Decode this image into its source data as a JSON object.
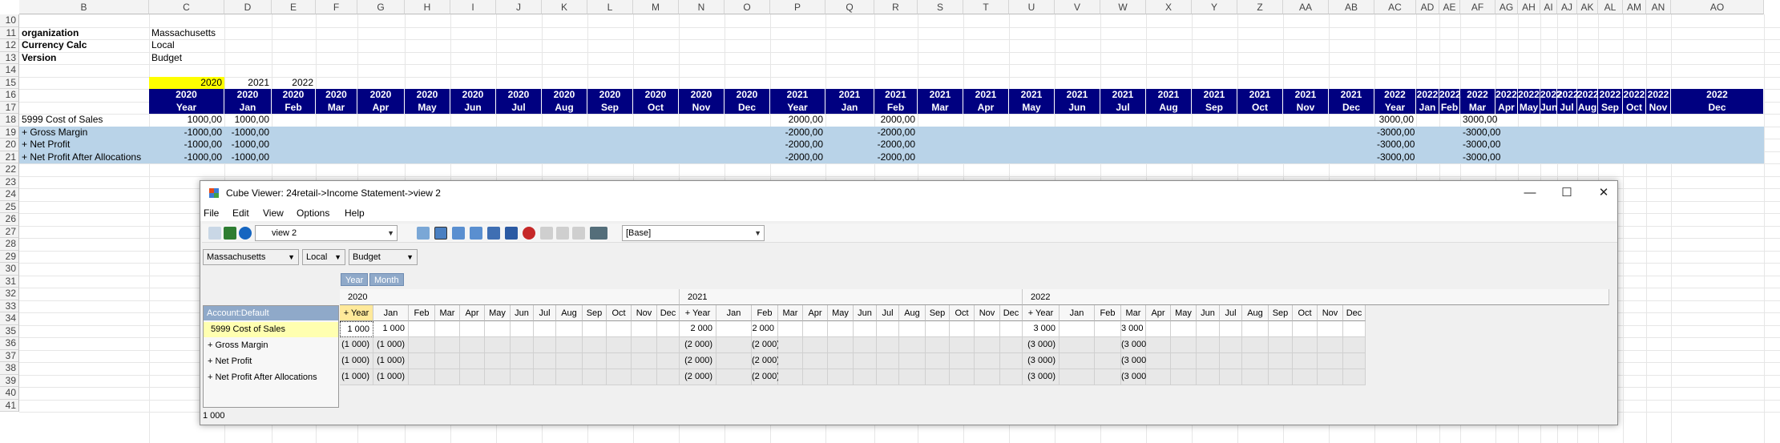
{
  "sheet": {
    "columns": [
      "B",
      "C",
      "D",
      "E",
      "F",
      "G",
      "H",
      "I",
      "J",
      "K",
      "L",
      "M",
      "N",
      "O",
      "P",
      "Q",
      "R",
      "S",
      "T",
      "U",
      "V",
      "W",
      "X",
      "Y",
      "Z",
      "AA",
      "AB",
      "AC",
      "AD",
      "AE",
      "AF",
      "AG",
      "AH",
      "AI",
      "AJ",
      "AK",
      "AL",
      "AM",
      "AN",
      "AO"
    ],
    "rows": [
      "10",
      "11",
      "12",
      "13",
      "14",
      "15",
      "16",
      "17",
      "18",
      "19",
      "20",
      "21",
      "22",
      "23",
      "24",
      "25",
      "26",
      "27",
      "28",
      "29",
      "30",
      "31",
      "32",
      "33",
      "34",
      "35",
      "36",
      "37",
      "38",
      "39",
      "40",
      "41"
    ],
    "labels": {
      "organization": "organization",
      "organization_val": "Massachusetts",
      "currency": "Currency Calc",
      "currency_val": "Local",
      "version": "Version",
      "version_val": "Budget"
    },
    "year_row": [
      "2020",
      "2021",
      "2022"
    ],
    "header_years": [
      "2020",
      "2020",
      "2020",
      "2020",
      "2020",
      "2020",
      "2020",
      "2020",
      "2020",
      "2020",
      "2020",
      "2020",
      "2020",
      "2021",
      "2021",
      "2021",
      "2021",
      "2021",
      "2021",
      "2021",
      "2021",
      "2021",
      "2021",
      "2021",
      "2021",
      "2021",
      "2022",
      "2022",
      "2022",
      "2022",
      "2022",
      "2022",
      "2022",
      "2022",
      "2022",
      "2022",
      "2022",
      "2022",
      "2022"
    ],
    "header_periods": [
      "Year",
      "Jan",
      "Feb",
      "Mar",
      "Apr",
      "May",
      "Jun",
      "Jul",
      "Aug",
      "Sep",
      "Oct",
      "Nov",
      "Dec",
      "Year",
      "Jan",
      "Feb",
      "Mar",
      "Apr",
      "May",
      "Jun",
      "Jul",
      "Aug",
      "Sep",
      "Oct",
      "Nov",
      "Dec",
      "Year",
      "Jan",
      "Feb",
      "Mar",
      "Apr",
      "May",
      "Jun",
      "Jul",
      "Aug",
      "Sep",
      "Oct",
      "Nov",
      "Dec"
    ],
    "data_rows": [
      {
        "label": "5999 Cost of Sales",
        "c": "1000,00",
        "d": "1000,00",
        "p": "2000,00",
        "r": "2000,00",
        "ac": "3000,00",
        "af": "3000,00"
      },
      {
        "label": "+ Gross Margin",
        "c": "-1000,00",
        "d": "-1000,00",
        "p": "-2000,00",
        "r": "-2000,00",
        "ac": "-3000,00",
        "af": "-3000,00"
      },
      {
        "label": "+ Net Profit",
        "c": "-1000,00",
        "d": "-1000,00",
        "p": "-2000,00",
        "r": "-2000,00",
        "ac": "-3000,00",
        "af": "-3000,00"
      },
      {
        "label": "+ Net Profit After Allocations",
        "c": "-1000,00",
        "d": "-1000,00",
        "p": "-2000,00",
        "r": "-2000,00",
        "ac": "-3000,00",
        "af": "-3000,00"
      }
    ]
  },
  "window": {
    "title": "Cube Viewer: 24retail->Income Statement->view 2",
    "minimize": "—",
    "maximize": "☐",
    "close": "✕",
    "menu": [
      "File",
      "Edit",
      "View",
      "Options",
      "Help"
    ],
    "view_select": "view 2",
    "base_select": "[Base]",
    "filters": [
      "Massachusetts",
      "Local",
      "Budget"
    ],
    "chips": [
      "Year",
      "Month"
    ],
    "account_header": "Account:Default",
    "years": [
      "2020",
      "2021",
      "2022"
    ],
    "periods": [
      "+ Year",
      "Jan",
      "Feb",
      "Mar",
      "Apr",
      "May",
      "Jun",
      "Jul",
      "Aug",
      "Sep",
      "Oct",
      "Nov",
      "Dec",
      "+ Year",
      "Jan",
      "Feb",
      "Mar",
      "Apr",
      "May",
      "Jun",
      "Jul",
      "Aug",
      "Sep",
      "Oct",
      "Nov",
      "Dec",
      "+ Year",
      "Jan",
      "Feb",
      "Mar",
      "Apr",
      "May",
      "Jun",
      "Jul",
      "Aug",
      "Sep",
      "Oct",
      "Nov",
      "Dec"
    ],
    "rows": [
      {
        "label": "5999 Cost of Sales",
        "y1": "1 000",
        "jan1": "1 000",
        "y2": "2 000",
        "feb2": "2 000",
        "y3": "3 000",
        "mar3": "3 000"
      },
      {
        "label": "+ Gross Margin",
        "y1": "(1 000)",
        "jan1": "(1 000)",
        "y2": "(2 000)",
        "feb2": "(2 000)",
        "y3": "(3 000)",
        "mar3": "(3 000)"
      },
      {
        "label": "+ Net Profit",
        "y1": "(1 000)",
        "jan1": "(1 000)",
        "y2": "(2 000)",
        "feb2": "(2 000)",
        "y3": "(3 000)",
        "mar3": "(3 000)"
      },
      {
        "label": "+ Net Profit After Allocations",
        "y1": "(1 000)",
        "jan1": "(1 000)",
        "y2": "(2 000)",
        "feb2": "(2 000)",
        "y3": "(3 000)",
        "mar3": "(3 000)"
      }
    ],
    "status": "1 000"
  }
}
